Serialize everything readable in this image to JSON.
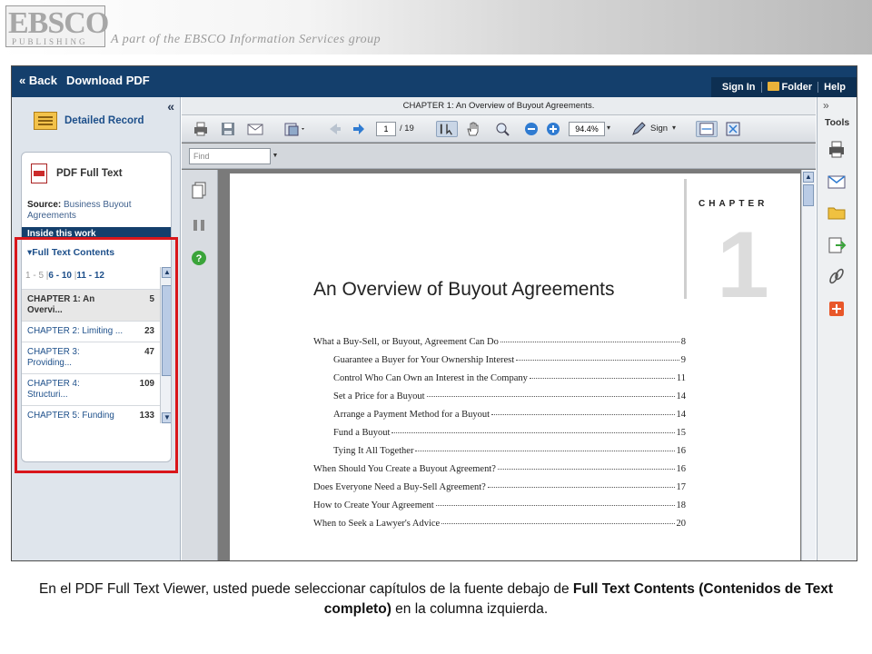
{
  "banner": {
    "logo_main": "EBSCO",
    "logo_sub": "PUBLISHING",
    "tagline": "A part of the EBSCO Information Services group"
  },
  "topbar": {
    "back_label": "« Back",
    "download_label": "Download PDF",
    "signin_label": "Sign In",
    "folder_label": "Folder",
    "help_label": "Help"
  },
  "left_panel": {
    "collapse_label": "«",
    "detailed_record_label": "Detailed Record",
    "pdf_full_text_label": "PDF Full Text",
    "source_label": "Source:",
    "source_value": "Business Buyout Agreements",
    "inside_label": "Inside this work",
    "full_text_contents_label": "▾Full Text Contents",
    "pager": {
      "first": "1 - 5",
      "second": "6 - 10",
      "third": "11 - 12"
    },
    "chapters": [
      {
        "title": "CHAPTER 1: An Overvi...",
        "page": "5"
      },
      {
        "title": "CHAPTER 2: Limiting ...",
        "page": "23"
      },
      {
        "title": "CHAPTER 3: Providing...",
        "page": "47"
      },
      {
        "title": "CHAPTER 4: Structuri...",
        "page": "109"
      },
      {
        "title": "CHAPTER 5: Funding",
        "page": "133"
      }
    ]
  },
  "viewer": {
    "doc_title": "CHAPTER 1: An Overview of Buyout Agreements.",
    "page_current": "1",
    "page_total": "/ 19",
    "zoom_value": "94.4%",
    "sign_label": "Sign",
    "find_placeholder": "Find"
  },
  "page_content": {
    "chapter_label": "CHAPTER",
    "chapter_number": "1",
    "title": "An Overview of Buyout Agreements",
    "toc": [
      {
        "text": "What a Buy-Sell, or Buyout, Agreement Can Do",
        "page": "8",
        "indent": false
      },
      {
        "text": "Guarantee a Buyer for Your Ownership Interest",
        "page": "9",
        "indent": true
      },
      {
        "text": "Control Who Can Own an Interest in the Company",
        "page": "11",
        "indent": true
      },
      {
        "text": "Set a Price for a Buyout",
        "page": "14",
        "indent": true
      },
      {
        "text": "Arrange a Payment Method for a Buyout",
        "page": "14",
        "indent": true
      },
      {
        "text": "Fund a Buyout",
        "page": "15",
        "indent": true
      },
      {
        "text": "Tying It All Together",
        "page": "16",
        "indent": true
      },
      {
        "text": "When Should You Create a Buyout Agreement?",
        "page": "16",
        "indent": false
      },
      {
        "text": "Does Everyone Need a Buy-Sell Agreement?",
        "page": "17",
        "indent": false
      },
      {
        "text": "How to Create Your Agreement",
        "page": "18",
        "indent": false
      },
      {
        "text": "When to Seek a Lawyer's Advice",
        "page": "20",
        "indent": false
      }
    ]
  },
  "tools_panel": {
    "expand_label": "»",
    "title": "Tools",
    "icons": [
      "print-icon",
      "email-icon",
      "save-folder-icon",
      "export-icon",
      "permalink-icon",
      "add-icon"
    ]
  },
  "caption": {
    "text_before": "En el PDF Full Text Viewer, usted puede seleccionar capítulos de la fuente debajo de ",
    "bold_part": "Full Text Contents (Contenidos de Text completo)",
    "text_after": " en la columna izquierda."
  },
  "colors": {
    "nav_blue": "#143f6c",
    "link_blue": "#1d4f8a",
    "highlight_red": "#d9161b"
  }
}
